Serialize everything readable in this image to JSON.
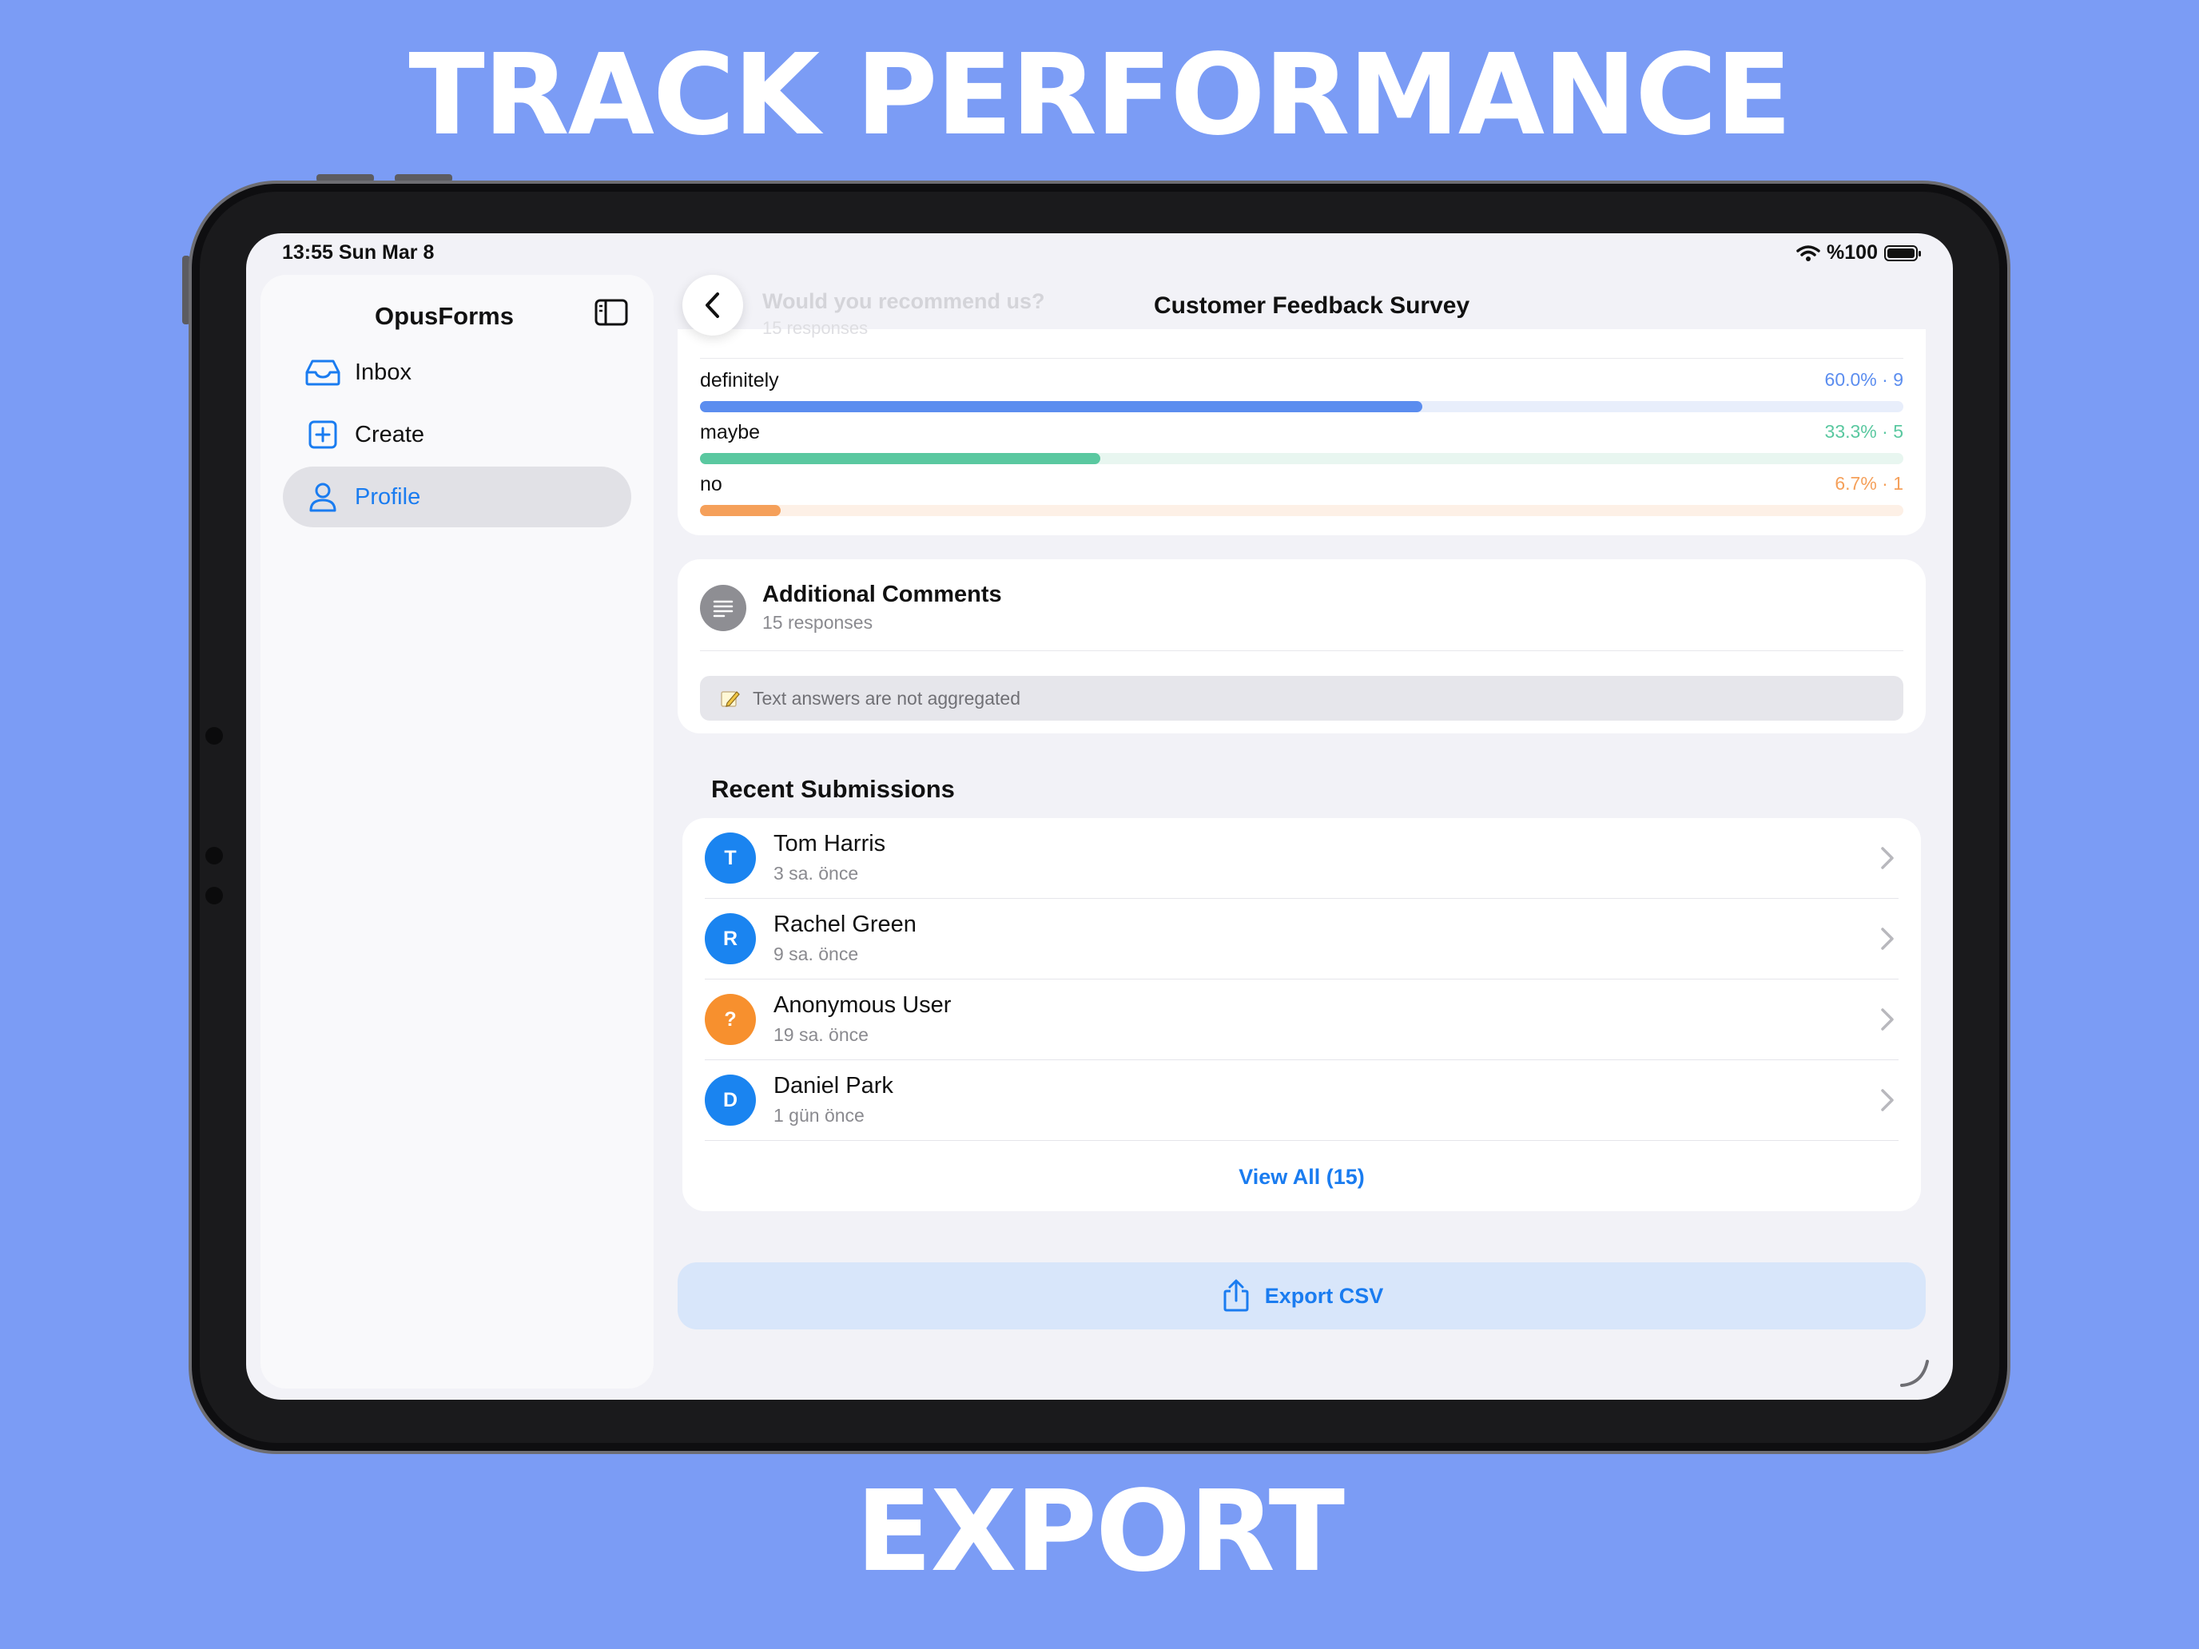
{
  "headline_top": "TRACK PERFORMANCE",
  "headline_bottom": "EXPORT",
  "status_bar": {
    "time_date": "13:55  Sun Mar 8",
    "battery": "%100"
  },
  "sidebar": {
    "title": "OpusForms",
    "items": [
      {
        "label": "Inbox",
        "icon": "inbox-icon",
        "active": false
      },
      {
        "label": "Create",
        "icon": "plus-square-icon",
        "active": false
      },
      {
        "label": "Profile",
        "icon": "person-icon",
        "active": true
      }
    ]
  },
  "nav": {
    "title": "Customer Feedback Survey",
    "collapsed_question": "Would you recommend us?",
    "collapsed_responses": "15 responses"
  },
  "question_results": {
    "options": [
      {
        "label": "definitely",
        "percent_text": "60.0% · 9",
        "fraction": 0.6,
        "color": "#5b8def",
        "track": "#e8eefb"
      },
      {
        "label": "maybe",
        "percent_text": "33.3% · 5",
        "fraction": 0.333,
        "color": "#5ac8a0",
        "track": "#e8f6f0"
      },
      {
        "label": "no",
        "percent_text": "6.7% · 1",
        "fraction": 0.067,
        "color": "#f5a05a",
        "track": "#fdf0e6"
      }
    ]
  },
  "comments_card": {
    "title": "Additional Comments",
    "responses": "15 responses",
    "note": "Text answers are not aggregated"
  },
  "recent": {
    "section_title": "Recent Submissions",
    "rows": [
      {
        "initial": "T",
        "name": "Tom Harris",
        "time": "3 sa. önce",
        "color": "#1a84f0"
      },
      {
        "initial": "R",
        "name": "Rachel Green",
        "time": "9 sa. önce",
        "color": "#1a84f0"
      },
      {
        "initial": "?",
        "name": "Anonymous User",
        "time": "19 sa. önce",
        "color": "#f7902e"
      },
      {
        "initial": "D",
        "name": "Daniel Park",
        "time": "1 gün önce",
        "color": "#1a84f0"
      }
    ],
    "view_all": "View All (15)"
  },
  "export_button": {
    "label": "Export CSV",
    "icon": "share-icon"
  },
  "colors": {
    "background": "#7b9cf5",
    "accent": "#1a7cf0"
  }
}
